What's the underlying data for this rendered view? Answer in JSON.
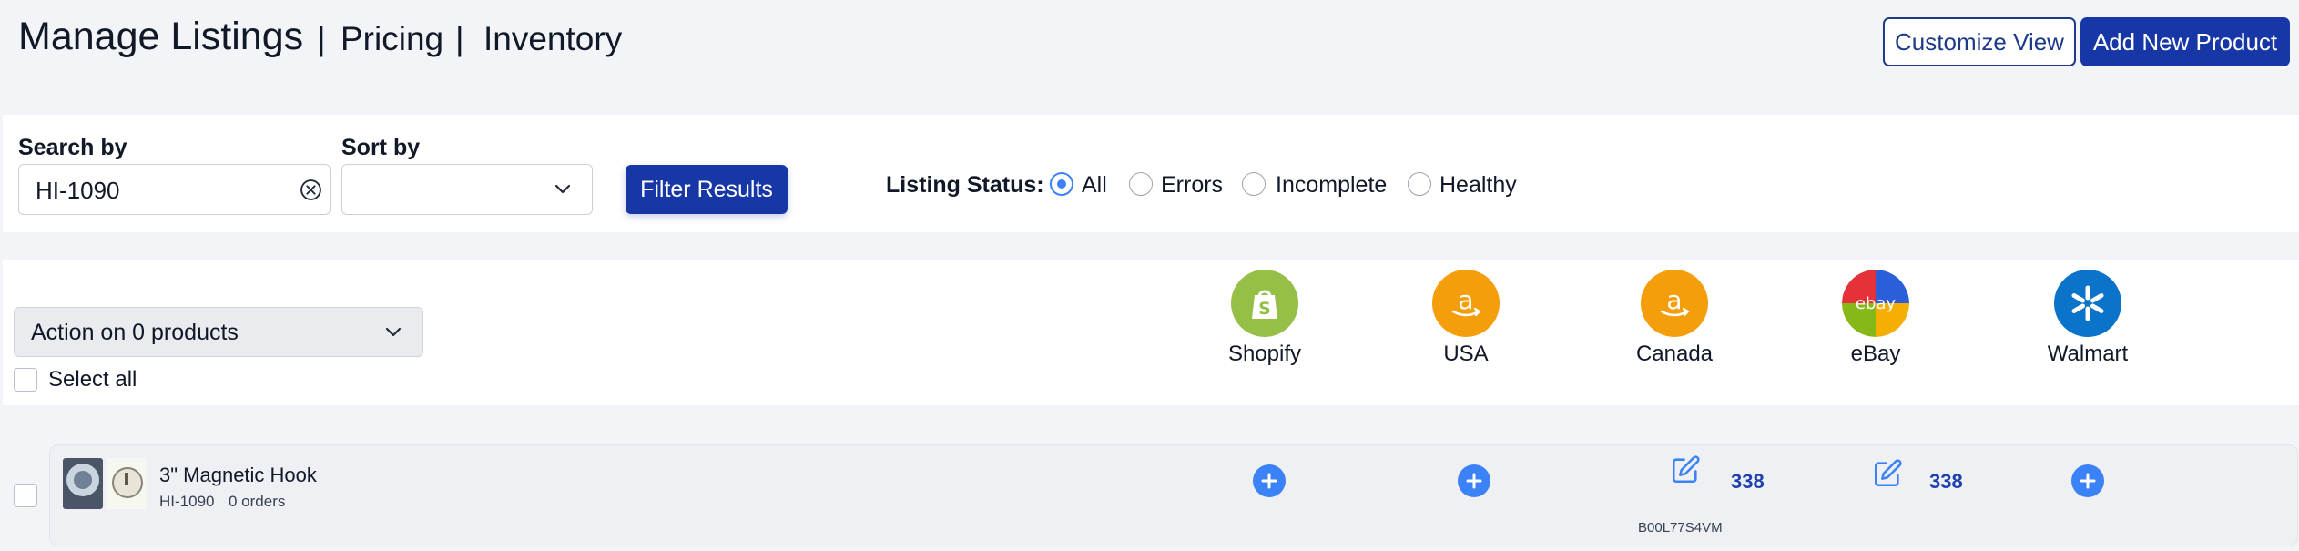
{
  "header": {
    "title": "Manage Listings",
    "nav": [
      {
        "sep": "|",
        "label": "Pricing"
      },
      {
        "sep": "|",
        "label": "Inventory"
      }
    ],
    "customize_label": "Customize View",
    "add_label": "Add New Product"
  },
  "filters": {
    "search_label": "Search by",
    "search_value": "HI-1090",
    "sort_label": "Sort by",
    "sort_value": "",
    "filter_button": "Filter Results",
    "status_label": "Listing Status:",
    "status_options": [
      "All",
      "Errors",
      "Incomplete",
      "Healthy"
    ],
    "status_selected": "All"
  },
  "bulk": {
    "action_label": "Action on 0 products",
    "select_all_label": "Select all"
  },
  "marketplaces": [
    {
      "name": "Shopify",
      "icon": "shopify-icon",
      "color": "#95bf47"
    },
    {
      "name": "USA",
      "icon": "amazon-icon",
      "color": "#f59e0b"
    },
    {
      "name": "Canada",
      "icon": "amazon-icon",
      "color": "#f59e0b"
    },
    {
      "name": "eBay",
      "icon": "ebay-icon",
      "color": "#e53238"
    },
    {
      "name": "Walmart",
      "icon": "walmart-icon",
      "color": "#0b73c9"
    }
  ],
  "products": [
    {
      "name": "3\" Magnetic Hook",
      "sku": "HI-1090",
      "orders": "0 orders",
      "canada_qty": "338",
      "canada_asin": "B00L77S4VM",
      "ebay_qty": "338"
    }
  ],
  "colors": {
    "primary": "#1737a6",
    "accent": "#3b82f6",
    "background": "#f3f4f7"
  }
}
